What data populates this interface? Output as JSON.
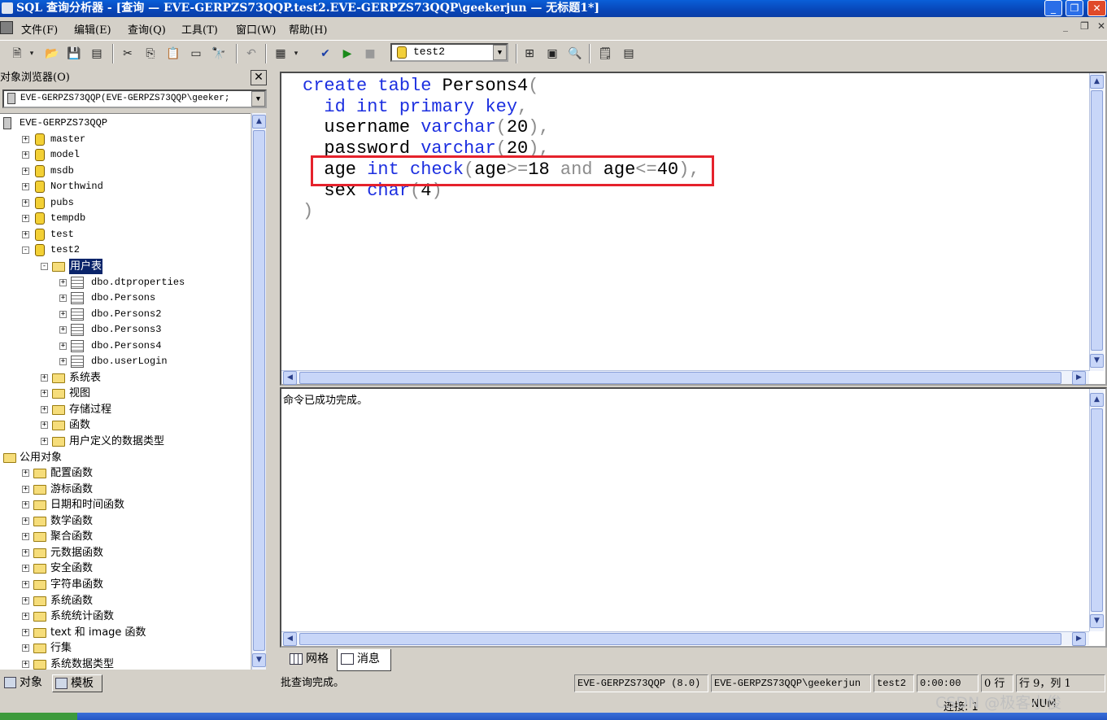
{
  "window": {
    "title": "SQL 查询分析器 - [查询 — EVE-GERPZS73QQP.test2.EVE-GERPZS73QQP\\geekerjun — 无标题1*]",
    "minimize": "_",
    "restore": "❐",
    "close": "✕"
  },
  "menu": {
    "items": [
      "文件(F)",
      "编辑(E)",
      "查询(Q)",
      "工具(T)",
      "窗口(W)",
      "帮助(H)"
    ],
    "mdi_min": "_",
    "mdi_restore": "❐",
    "mdi_close": "✕"
  },
  "toolbar": {
    "database": "test2"
  },
  "object_browser": {
    "title": "对象浏览器(O)",
    "server_combo": "EVE-GERPZS73QQP(EVE-GERPZS73QQP\\geeker;",
    "tree": [
      {
        "label": "EVE-GERPZS73QQP",
        "level": 0,
        "icon": "server-icon",
        "pm": ""
      },
      {
        "label": "master",
        "level": 1,
        "icon": "database-icon",
        "pm": "+"
      },
      {
        "label": "model",
        "level": 1,
        "icon": "database-icon",
        "pm": "+"
      },
      {
        "label": "msdb",
        "level": 1,
        "icon": "database-icon",
        "pm": "+"
      },
      {
        "label": "Northwind",
        "level": 1,
        "icon": "database-icon",
        "pm": "+"
      },
      {
        "label": "pubs",
        "level": 1,
        "icon": "database-icon",
        "pm": "+"
      },
      {
        "label": "tempdb",
        "level": 1,
        "icon": "database-icon",
        "pm": "+"
      },
      {
        "label": "test",
        "level": 1,
        "icon": "database-icon",
        "pm": "+"
      },
      {
        "label": "test2",
        "level": 1,
        "icon": "database-icon",
        "pm": "−"
      },
      {
        "label": "用户表",
        "level": 2,
        "icon": "folder-icon",
        "pm": "−",
        "selected": true
      },
      {
        "label": "dbo.dtproperties",
        "level": 3,
        "icon": "table-icon",
        "pm": "+"
      },
      {
        "label": "dbo.Persons",
        "level": 3,
        "icon": "table-icon",
        "pm": "+"
      },
      {
        "label": "dbo.Persons2",
        "level": 3,
        "icon": "table-icon",
        "pm": "+"
      },
      {
        "label": "dbo.Persons3",
        "level": 3,
        "icon": "table-icon",
        "pm": "+"
      },
      {
        "label": "dbo.Persons4",
        "level": 3,
        "icon": "table-icon",
        "pm": "+"
      },
      {
        "label": "dbo.userLogin",
        "level": 3,
        "icon": "table-icon",
        "pm": "+"
      },
      {
        "label": "系统表",
        "level": 2,
        "icon": "folder-icon",
        "pm": "+"
      },
      {
        "label": "视图",
        "level": 2,
        "icon": "folder-icon",
        "pm": "+"
      },
      {
        "label": "存储过程",
        "level": 2,
        "icon": "folder-icon",
        "pm": "+"
      },
      {
        "label": "函数",
        "level": 2,
        "icon": "folder-icon",
        "pm": "+"
      },
      {
        "label": "用户定义的数据类型",
        "level": 2,
        "icon": "folder-icon",
        "pm": "+"
      },
      {
        "label": "公用对象",
        "level": 0,
        "icon": "folder-icon",
        "pm": ""
      },
      {
        "label": "配置函数",
        "level": 1,
        "icon": "folder-icon",
        "pm": "+"
      },
      {
        "label": "游标函数",
        "level": 1,
        "icon": "folder-icon",
        "pm": "+"
      },
      {
        "label": "日期和时间函数",
        "level": 1,
        "icon": "folder-icon",
        "pm": "+"
      },
      {
        "label": "数学函数",
        "level": 1,
        "icon": "folder-icon",
        "pm": "+"
      },
      {
        "label": "聚合函数",
        "level": 1,
        "icon": "folder-icon",
        "pm": "+"
      },
      {
        "label": "元数据函数",
        "level": 1,
        "icon": "folder-icon",
        "pm": "+"
      },
      {
        "label": "安全函数",
        "level": 1,
        "icon": "folder-icon",
        "pm": "+"
      },
      {
        "label": "字符串函数",
        "level": 1,
        "icon": "folder-icon",
        "pm": "+"
      },
      {
        "label": "系统函数",
        "level": 1,
        "icon": "folder-icon",
        "pm": "+"
      },
      {
        "label": "系统统计函数",
        "level": 1,
        "icon": "folder-icon",
        "pm": "+"
      },
      {
        "label": "text 和 image 函数",
        "level": 1,
        "icon": "folder-icon",
        "pm": "+"
      },
      {
        "label": "行集",
        "level": 1,
        "icon": "folder-icon",
        "pm": "+"
      },
      {
        "label": "系统数据类型",
        "level": 1,
        "icon": "folder-icon",
        "pm": "+"
      }
    ],
    "tabs": [
      "对象",
      "模板"
    ]
  },
  "editor": {
    "lines": [
      [
        [
          "kw",
          "create table "
        ],
        [
          "",
          "Persons4"
        ],
        [
          "op",
          "("
        ]
      ],
      [
        [
          "",
          "  "
        ],
        [
          "kw",
          "id int primary key"
        ],
        [
          "op",
          ","
        ]
      ],
      [
        [
          "",
          "  username "
        ],
        [
          "kw",
          "varchar"
        ],
        [
          "op",
          "("
        ],
        [
          "",
          "20"
        ],
        [
          "op",
          "),"
        ]
      ],
      [
        [
          "",
          "  password "
        ],
        [
          "kw",
          "varchar"
        ],
        [
          "op",
          "("
        ],
        [
          "",
          "20"
        ],
        [
          "op",
          "),"
        ]
      ],
      [
        [
          "",
          "  age "
        ],
        [
          "kw",
          "int check"
        ],
        [
          "op",
          "("
        ],
        [
          "",
          "age"
        ],
        [
          "op",
          ">="
        ],
        [
          "",
          "18 "
        ],
        [
          "op",
          "and "
        ],
        [
          "",
          "age"
        ],
        [
          "op",
          "<="
        ],
        [
          "",
          "40"
        ],
        [
          "op",
          "),"
        ]
      ],
      [
        [
          "",
          "  sex "
        ],
        [
          "kw",
          "char"
        ],
        [
          "op",
          "("
        ],
        [
          "",
          "4"
        ],
        [
          "op",
          ")"
        ]
      ],
      [
        [
          "op",
          ")"
        ]
      ]
    ]
  },
  "results": {
    "message": "命令已成功完成。",
    "tabs": [
      "网格",
      "消息"
    ]
  },
  "status": {
    "text": "批查询完成。",
    "server": "EVE-GERPZS73QQP (8.0)",
    "user": "EVE-GERPZS73QQP\\geekerjun",
    "db": "test2",
    "time": "0:00:00",
    "rows": "0 行",
    "position": "行 9，列 1",
    "connections": "连接: 1",
    "mode": "NUM"
  },
  "watermark": "CSDN @极客小俊",
  "colors": {
    "keyword": "#1c2fe0",
    "operator": "#8c8c8c",
    "highlight_box": "#e5222c",
    "selection": "#0a246a"
  }
}
